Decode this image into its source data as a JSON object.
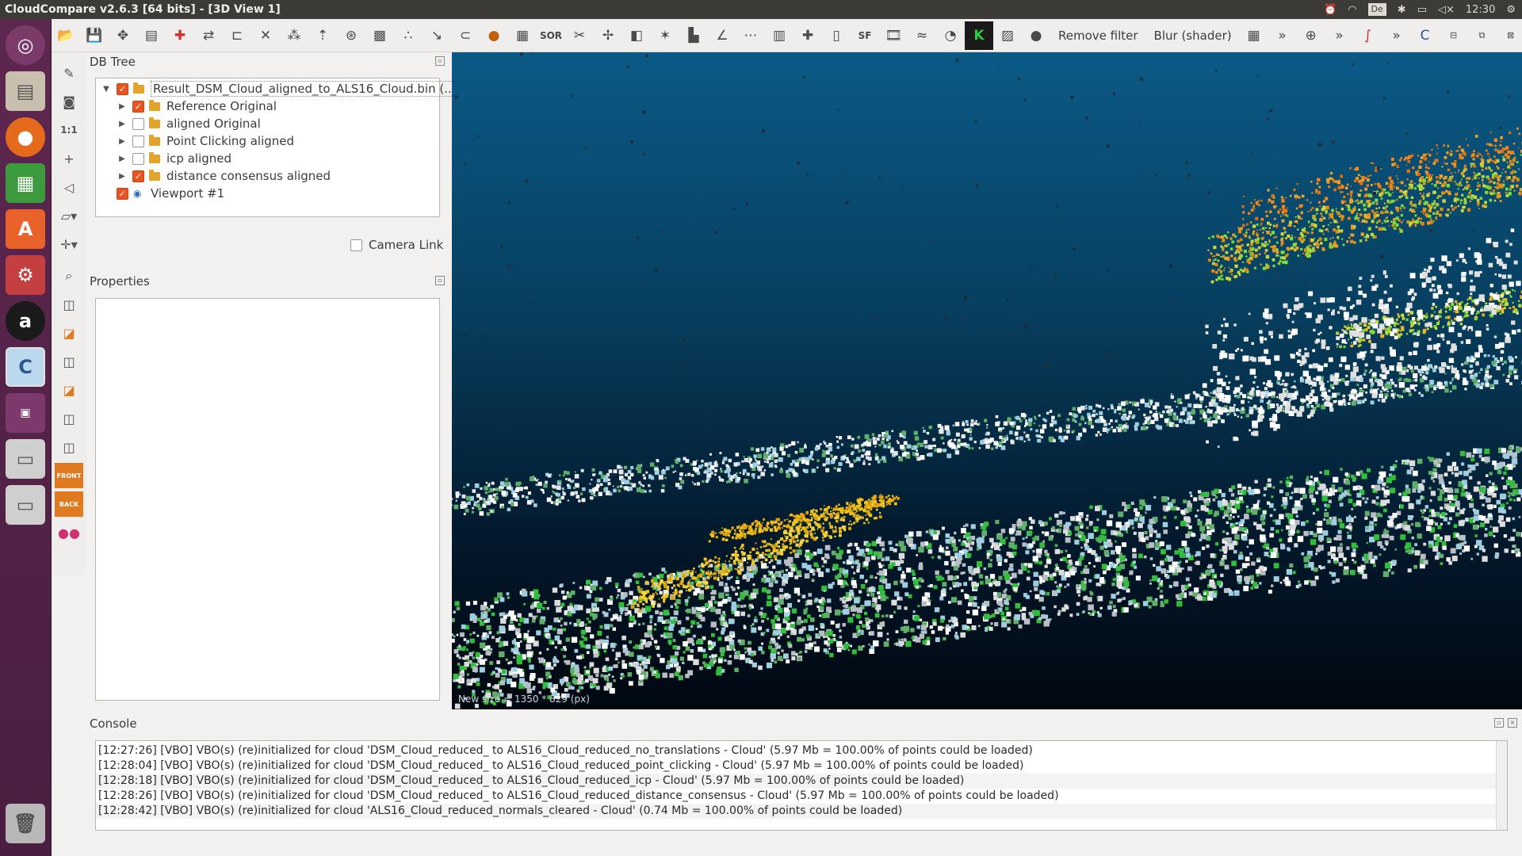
{
  "window": {
    "title": "CloudCompare v2.6.3 [64 bits] - [3D View 1]"
  },
  "indicators": {
    "keyboard": "De",
    "clock": "12:30"
  },
  "launcher": {
    "items": [
      "ubuntu-dash",
      "file-manager",
      "firefox",
      "libreoffice-calc",
      "software-center",
      "system-settings",
      "amazon",
      "cloudcompare",
      "workspace-switcher",
      "drive-1",
      "drive-2",
      "trash"
    ]
  },
  "toolbar": {
    "remove_filter": "Remove filter",
    "blur_shader": "Blur (shader)",
    "more": "»",
    "sf_label": "SF",
    "sor_label": "SOR"
  },
  "left_toolbar": {
    "ratio_label": "1:1",
    "front_label": "FRONT",
    "back_label": "BACK"
  },
  "dbtree": {
    "title": "DB Tree",
    "items": [
      {
        "label": "Result_DSM_Cloud_aligned_to_ALS16_Cloud.bin (...",
        "checked": true,
        "level": 0,
        "type": "folder",
        "expanded": true
      },
      {
        "label": "Reference Original",
        "checked": true,
        "level": 1,
        "type": "folder"
      },
      {
        "label": "aligned Original",
        "checked": false,
        "level": 1,
        "type": "folder"
      },
      {
        "label": "Point Clicking aligned",
        "checked": false,
        "level": 1,
        "type": "folder"
      },
      {
        "label": "icp aligned",
        "checked": false,
        "level": 1,
        "type": "folder"
      },
      {
        "label": "distance consensus aligned",
        "checked": true,
        "level": 1,
        "type": "folder"
      },
      {
        "label": "Viewport #1",
        "checked": true,
        "level": 0,
        "type": "viewport"
      }
    ],
    "camera_link": "Camera Link"
  },
  "properties": {
    "title": "Properties"
  },
  "view3d": {
    "overlay_text": "New size = 1350 * 829 (px)"
  },
  "console": {
    "title": "Console",
    "lines": [
      "[12:27:26] [VBO] VBO(s) (re)initialized for cloud 'DSM_Cloud_reduced_ to ALS16_Cloud_reduced_no_translations - Cloud' (5.97 Mb = 100.00% of points could be loaded)",
      "[12:28:04] [VBO] VBO(s) (re)initialized for cloud 'DSM_Cloud_reduced_ to ALS16_Cloud_reduced_point_clicking - Cloud' (5.97 Mb = 100.00% of points could be loaded)",
      "[12:28:18] [VBO] VBO(s) (re)initialized for cloud 'DSM_Cloud_reduced_ to ALS16_Cloud_reduced_icp - Cloud' (5.97 Mb = 100.00% of points could be loaded)",
      "[12:28:26] [VBO] VBO(s) (re)initialized for cloud 'DSM_Cloud_reduced_ to ALS16_Cloud_reduced_distance_consensus - Cloud' (5.97 Mb = 100.00% of points could be loaded)",
      "[12:28:42] [VBO] VBO(s) (re)initialized for cloud 'ALS16_Cloud_reduced_normals_cleared - Cloud' (0.74 Mb = 100.00% of points could be loaded)"
    ]
  },
  "colors": {
    "accent": "#e95420",
    "launcher": "#5e2750",
    "view_top": "#0a5a86",
    "view_bottom": "#010810"
  }
}
